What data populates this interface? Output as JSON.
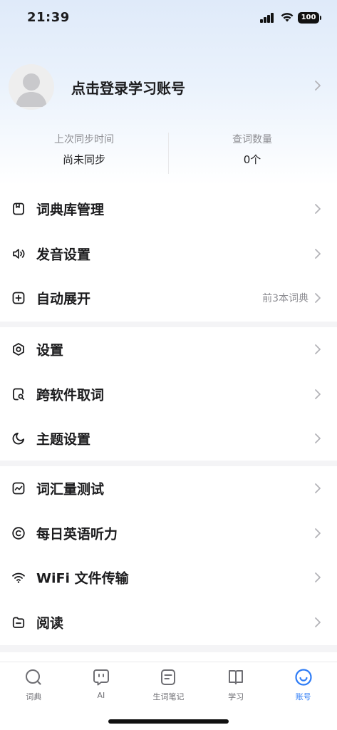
{
  "status_bar": {
    "time": "21:39",
    "battery": "100"
  },
  "header": {
    "login_title": "点击登录学习账号",
    "last_sync_label": "上次同步时间",
    "last_sync_value": "尚未同步",
    "lookup_count_label": "查词数量",
    "lookup_count_value": "0个"
  },
  "menu": {
    "section1": [
      {
        "label": "词典库管理",
        "icon": "book-icon"
      },
      {
        "label": "发音设置",
        "icon": "speaker-icon"
      },
      {
        "label": "自动展开",
        "icon": "plus-square-icon",
        "extra": "前3本词典"
      }
    ],
    "section2": [
      {
        "label": "设置",
        "icon": "hexagon-settings-icon"
      },
      {
        "label": "跨软件取词",
        "icon": "search-document-icon"
      },
      {
        "label": "主题设置",
        "icon": "moon-icon"
      }
    ],
    "section3": [
      {
        "label": "词汇量测试",
        "icon": "chart-icon"
      },
      {
        "label": "每日英语听力",
        "icon": "circle-c-icon"
      },
      {
        "label": "WiFi 文件传输",
        "icon": "wifi-icon"
      },
      {
        "label": "阅读",
        "icon": "folder-icon"
      }
    ]
  },
  "tabs": [
    {
      "label": "词典",
      "icon": "search-icon"
    },
    {
      "label": "AI",
      "icon": "ai-icon"
    },
    {
      "label": "生词笔记",
      "icon": "notes-icon"
    },
    {
      "label": "学习",
      "icon": "open-book-icon"
    },
    {
      "label": "账号",
      "icon": "smile-icon",
      "active": true
    }
  ],
  "colors": {
    "accent": "#2e7cf6",
    "text": "#1c1c1e",
    "muted": "#8e8e93"
  }
}
